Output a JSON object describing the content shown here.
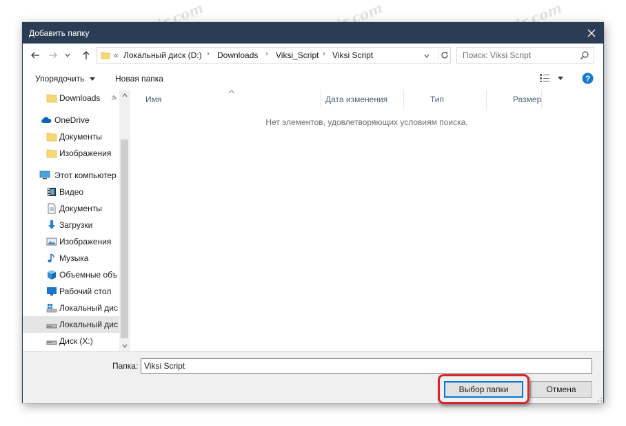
{
  "window": {
    "title": "Добавить папку"
  },
  "address": {
    "overflow": "«",
    "crumbs": [
      "Локальный диск (D:)",
      "Downloads",
      "Viksi_Script",
      "Viksi Script"
    ],
    "separator": "›"
  },
  "search": {
    "placeholder": "Поиск: Viksi Script"
  },
  "toolbar": {
    "organize_label": "Упорядочить",
    "new_folder_label": "Новая папка"
  },
  "nav": {
    "items": [
      {
        "label": "Downloads",
        "icon": "folder-icon",
        "pinned": true
      },
      {
        "label": "OneDrive",
        "icon": "onedrive-cloud-icon"
      },
      {
        "label": "Документы",
        "icon": "folder-icon"
      },
      {
        "label": "Изображения",
        "icon": "folder-icon"
      },
      {
        "label": "Этот компьютер",
        "icon": "computer-icon"
      },
      {
        "label": "Видео",
        "icon": "video-icon"
      },
      {
        "label": "Документы",
        "icon": "documents-icon"
      },
      {
        "label": "Загрузки",
        "icon": "download-icon"
      },
      {
        "label": "Изображения",
        "icon": "pictures-icon"
      },
      {
        "label": "Музыка",
        "icon": "music-icon"
      },
      {
        "label": "Объемные объ",
        "icon": "3d-objects-icon"
      },
      {
        "label": "Рабочий стол",
        "icon": "desktop-icon"
      },
      {
        "label": "Локальный дис",
        "icon": "windows-drive-icon"
      },
      {
        "label": "Локальный дис",
        "icon": "drive-icon",
        "selected": true
      },
      {
        "label": "Диск (X:)",
        "icon": "drive-icon"
      }
    ]
  },
  "columns": [
    "Имя",
    "Дата изменения",
    "Тип",
    "Размер"
  ],
  "empty_message": "Нет элементов, удовлетворяющих условиям поиска.",
  "footer": {
    "folder_label": "Папка:",
    "folder_value": "Viksi Script",
    "select_button": "Выбор папки",
    "cancel_button": "Отмена"
  },
  "watermark": "Sovingpcrepair.com",
  "colors": {
    "titlebar": "#2b3d54",
    "accent": "#0078d7",
    "highlight": "#d8242b",
    "header_text": "#4c607a"
  }
}
